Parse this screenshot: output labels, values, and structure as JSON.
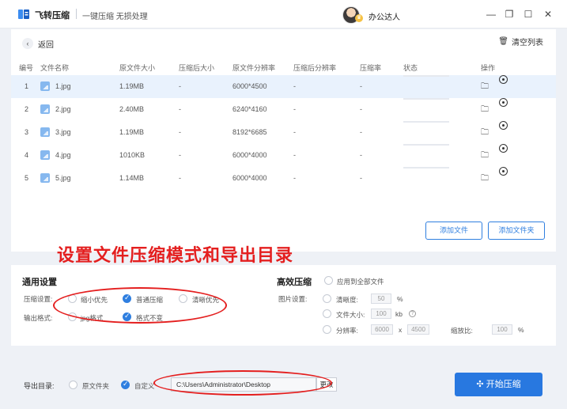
{
  "titlebar": {
    "app_name": "飞转压缩",
    "slogan": "一键压缩 无损处理",
    "username": "办公达人",
    "minimize": "—",
    "restore": "❐",
    "maximize": "☐",
    "close": "✕"
  },
  "toolbar": {
    "back_label": "返回",
    "clear_label": "清空列表"
  },
  "table": {
    "columns": [
      "编号",
      "文件名称",
      "原文件大小",
      "压缩后大小",
      "原文件分辨率",
      "压缩后分辨率",
      "压缩率",
      "状态",
      "操作"
    ],
    "rows": [
      {
        "no": "1",
        "name": "1.jpg",
        "size": "1.19MB",
        "new_size": "-",
        "res": "6000*4500",
        "new_res": "-",
        "ratio": "-"
      },
      {
        "no": "2",
        "name": "2.jpg",
        "size": "2.40MB",
        "new_size": "-",
        "res": "6240*4160",
        "new_res": "-",
        "ratio": "-"
      },
      {
        "no": "3",
        "name": "3.jpg",
        "size": "1.19MB",
        "new_size": "-",
        "res": "8192*6685",
        "new_res": "-",
        "ratio": "-"
      },
      {
        "no": "4",
        "name": "4.jpg",
        "size": "1010KB",
        "new_size": "-",
        "res": "6000*4000",
        "new_res": "-",
        "ratio": "-"
      },
      {
        "no": "5",
        "name": "5.jpg",
        "size": "1.14MB",
        "new_size": "-",
        "res": "6000*4000",
        "new_res": "-",
        "ratio": "-"
      }
    ]
  },
  "buttons": {
    "add_file": "添加文件",
    "add_folder": "添加文件夹",
    "start": "开始压缩",
    "change": "更改"
  },
  "annotation": {
    "title": "设置文件压缩模式和导出目录"
  },
  "general_settings": {
    "title": "通用设置",
    "compress_label": "压缩设置:",
    "compress_options": [
      "缩小优先",
      "普通压缩",
      "清晰优先"
    ],
    "compress_selected": "普通压缩",
    "output_label": "输出格式:",
    "output_options": [
      "jpg格式",
      "格式不变"
    ],
    "output_selected": "格式不变"
  },
  "efficient": {
    "title": "高效压缩",
    "apply_all": "应用到全部文件",
    "image_label": "图片设置:",
    "clarity_label": "清晰度:",
    "clarity_value": "50",
    "clarity_unit": "%",
    "size_label": "文件大小:",
    "size_value": "100",
    "size_unit": "kb",
    "res_label": "分辨率:",
    "res_w": "6000",
    "res_x": "x",
    "res_h": "4500",
    "scale_label": "缩放比:",
    "scale_value": "100",
    "scale_unit": "%"
  },
  "export": {
    "label": "导出目录:",
    "opt_original": "原文件夹",
    "opt_custom": "自定义",
    "path": "C:\\Users\\Administrator\\Desktop"
  },
  "colors": {
    "accent": "#2f7fe0",
    "annotation": "#e41f1f"
  },
  "icons": {
    "back": "‹",
    "trash": "🗑",
    "folder": "🗀",
    "start": "✣"
  }
}
